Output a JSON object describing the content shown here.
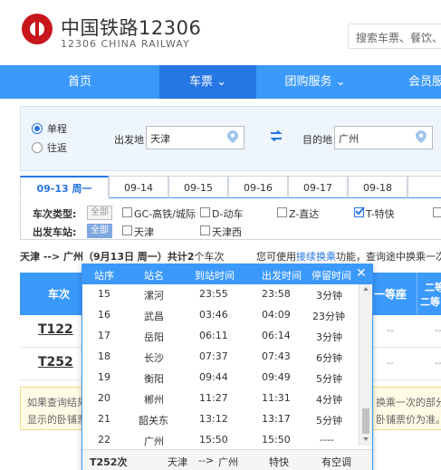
{
  "header": {
    "brand_cn": "中国铁路12306",
    "brand_en": "12306 CHINA RAILWAY",
    "search_placeholder": "搜索车票、餐饮、"
  },
  "nav": {
    "items": [
      {
        "label": "首页"
      },
      {
        "label": "车票"
      },
      {
        "label": "团购服务"
      },
      {
        "label": "会员服"
      }
    ]
  },
  "query": {
    "trip_single": "单程",
    "trip_round": "往返",
    "from_label": "出发地",
    "from_value": "天津",
    "to_label": "目的地",
    "to_value": "广州"
  },
  "date_tabs": [
    "09-13 周一",
    "09-14",
    "09-15",
    "09-16",
    "09-17",
    "09-18"
  ],
  "filters": {
    "type_label": "车次类型:",
    "type_all": "全部",
    "types": [
      "GC-高铁/城际",
      "D-动车",
      "Z-直达",
      "T-特快"
    ],
    "station_label": "出发车站:",
    "station_all": "全部",
    "stations": [
      "天津",
      "天津西"
    ]
  },
  "summary": {
    "route": "天津 --> 广州（9月13日 周一）共计",
    "count": "2",
    "suffix": "个车次",
    "hint_prefix": "您可使用",
    "hint_link": "接续换乘",
    "hint_suffix": "功能，查询途中换乘一次"
  },
  "results": {
    "col_train": "车次",
    "col_first": "一等座",
    "col_second": "二等",
    "col_second2": "二等",
    "trains": [
      "T122",
      "T252"
    ],
    "dash": "--",
    "notice_line1_left": "如果查询结果",
    "notice_line1_right": "换乘一次的部分",
    "notice_line2_left": "显示的卧铺票",
    "notice_line2_right": "卧铺票价为准。"
  },
  "popup": {
    "headers": [
      "站序",
      "站名",
      "到站时间",
      "出发时间",
      "停留时间"
    ],
    "close": "✕",
    "stops": [
      {
        "no": "15",
        "name": "漯河",
        "arr": "23:55",
        "dep": "23:58",
        "stay": "3分钟"
      },
      {
        "no": "16",
        "name": "武昌",
        "arr": "03:46",
        "dep": "04:09",
        "stay": "23分钟"
      },
      {
        "no": "17",
        "name": "岳阳",
        "arr": "06:11",
        "dep": "06:14",
        "stay": "3分钟"
      },
      {
        "no": "18",
        "name": "长沙",
        "arr": "07:37",
        "dep": "07:43",
        "stay": "6分钟"
      },
      {
        "no": "19",
        "name": "衡阳",
        "arr": "09:44",
        "dep": "09:49",
        "stay": "5分钟"
      },
      {
        "no": "20",
        "name": "郴州",
        "arr": "11:27",
        "dep": "11:31",
        "stay": "4分钟"
      },
      {
        "no": "21",
        "name": "韶关东",
        "arr": "13:12",
        "dep": "13:17",
        "stay": "5分钟"
      },
      {
        "no": "22",
        "name": "广州",
        "arr": "15:50",
        "dep": "15:50",
        "stay": "----"
      }
    ],
    "footer": {
      "train": "T252次",
      "from": "天津",
      "arrow": "-->",
      "to": "广州",
      "type": "特快",
      "ac": "有空调"
    }
  },
  "colors": {
    "nav_blue": "#3b99fc",
    "nav_active": "#2676e3",
    "brand_red": "#c8161d"
  }
}
